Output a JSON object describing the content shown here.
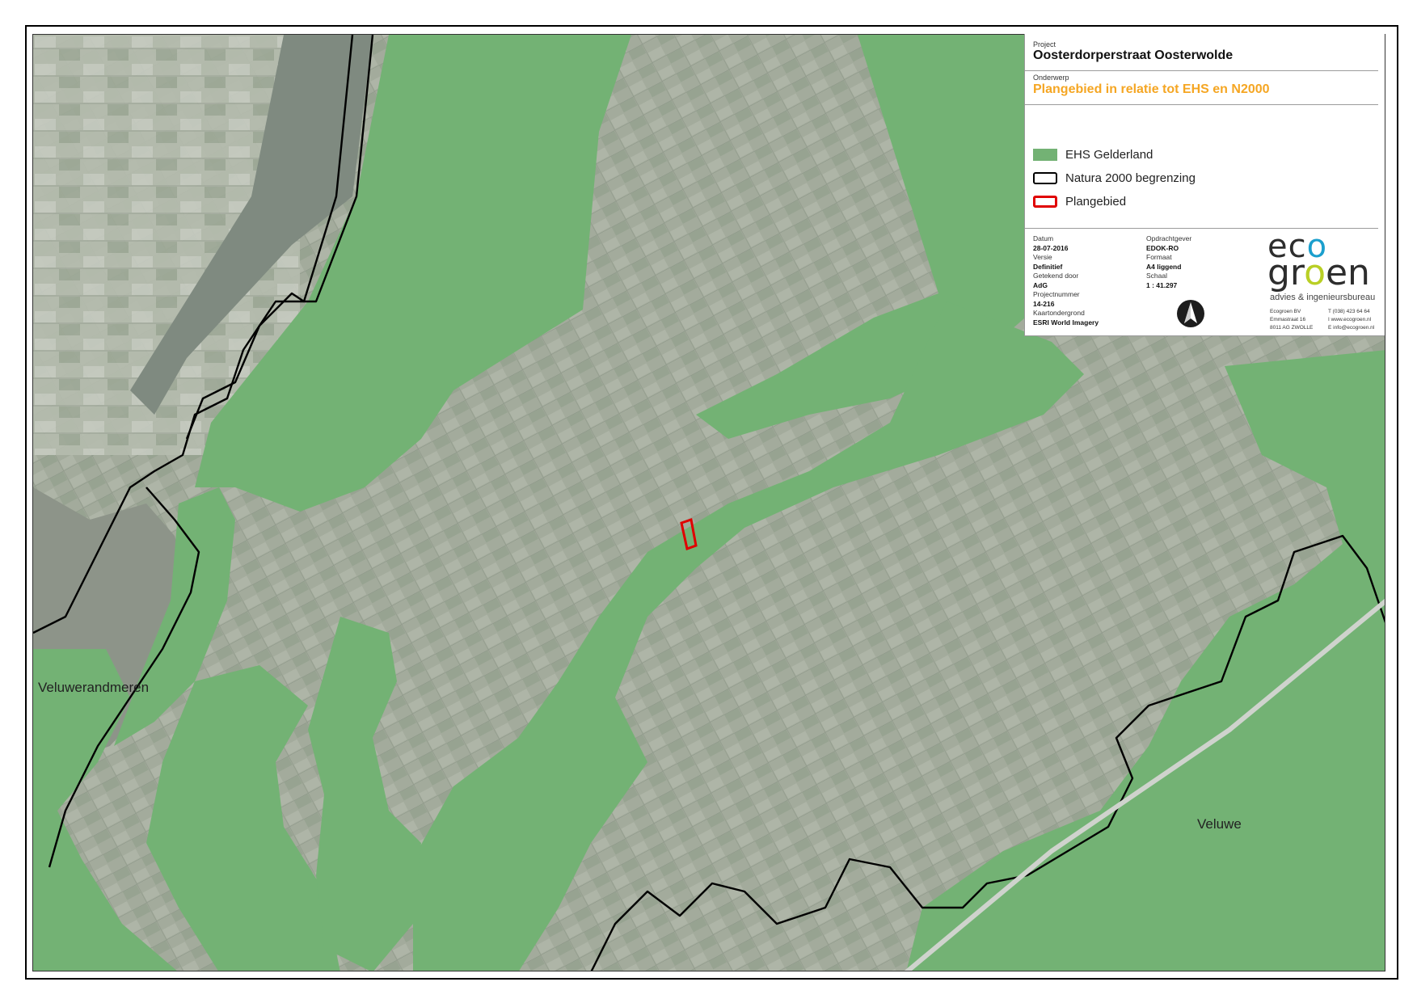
{
  "project": {
    "label": "Project",
    "value": "Oosterdorperstraat Oosterwolde"
  },
  "subject": {
    "label": "Onderwerp",
    "value": "Plangebied in relatie tot EHS en N2000"
  },
  "legend": [
    {
      "label": "EHS Gelderland",
      "color": "#73b274",
      "style": "fill"
    },
    {
      "label": "Natura 2000 begrenzing",
      "color": "#000000",
      "style": "outline"
    },
    {
      "label": "Plangebied",
      "color": "#e00000",
      "style": "outline"
    }
  ],
  "meta_left": [
    {
      "label": "Datum",
      "value": "28-07-2016"
    },
    {
      "label": "Versie",
      "value": "Definitief"
    },
    {
      "label": "Getekend door",
      "value": "AdG"
    },
    {
      "label": "Projectnummer",
      "value": "14-216"
    },
    {
      "label": "Kaartondergrond",
      "value": "ESRI World Imagery"
    }
  ],
  "meta_right": [
    {
      "label": "Opdrachtgever",
      "value": "EDOK-RO"
    },
    {
      "label": "Formaat",
      "value": "A4 liggend"
    },
    {
      "label": "Schaal",
      "value": "1 : 41.297"
    }
  ],
  "logo": {
    "line1_a": "ec",
    "line1_b": "o",
    "line2_a": "gr",
    "line2_b": "o",
    "line2_c": "en",
    "subtitle": "advies & ingenieursbureau"
  },
  "contact": {
    "col1": [
      "Ecogroen BV",
      "Emmastraat 16",
      "8011 AG ZWOLLE"
    ],
    "col2": [
      "T (038) 423 64 64",
      "I www.ecogroen.nl",
      "E info@ecogroen.nl"
    ]
  },
  "place_labels": {
    "veluwerandmeren": "Veluwerandmeren",
    "veluwe": "Veluwe"
  },
  "colors": {
    "ehs": "#73b274",
    "n2000": "#000000",
    "plangebied": "#e00000",
    "title_accent": "#f5a623",
    "aerial": "#9aa596"
  }
}
